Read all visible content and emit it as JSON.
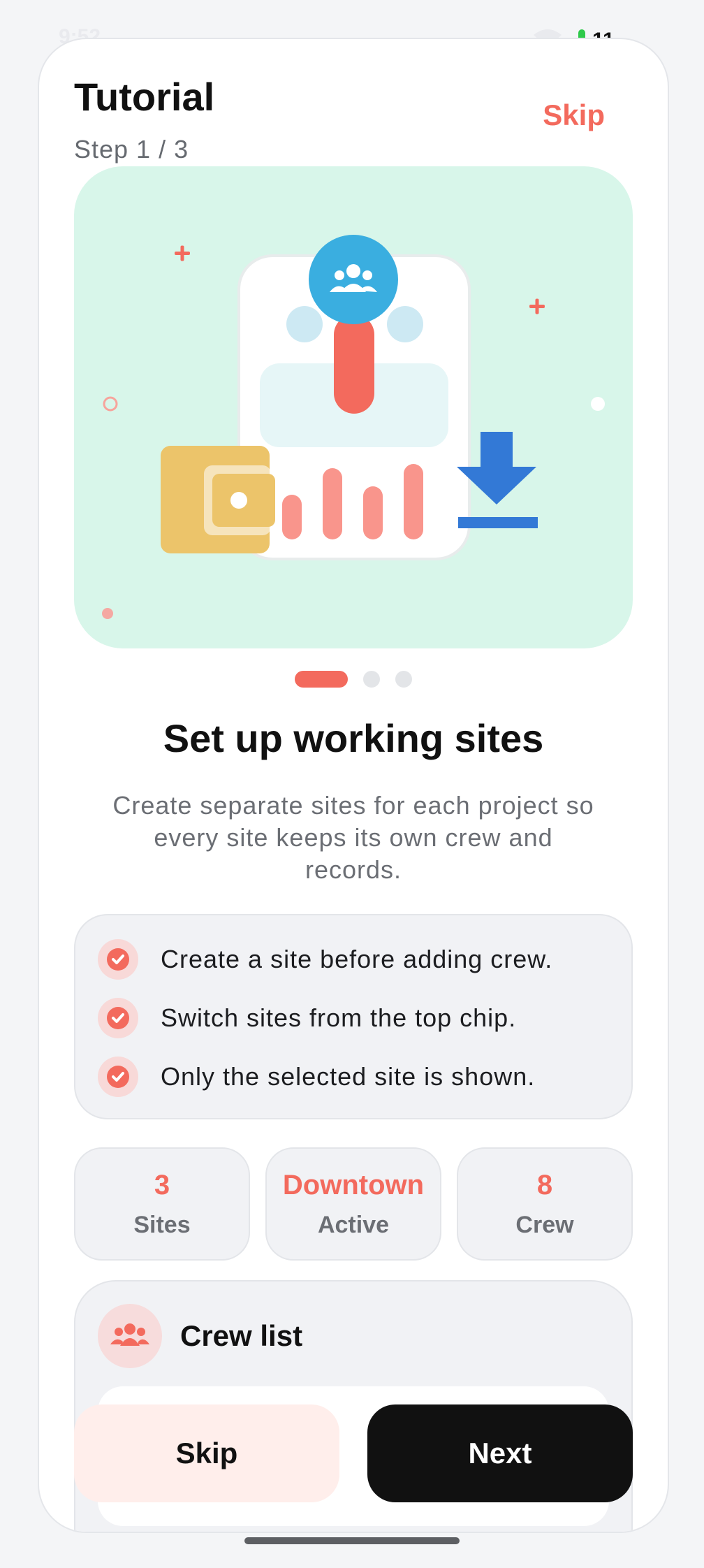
{
  "status_bar": {
    "time": "9:52",
    "battery": "11"
  },
  "header": {
    "title": "Tutorial",
    "step": "Step 1 / 3",
    "skip_label": "Skip"
  },
  "hero": {
    "illustration_icons": [
      "group-icon",
      "wallet-icon",
      "bar-chart-icon",
      "download-icon"
    ],
    "background_color": "#d8f6ea"
  },
  "pager": {
    "current": 1,
    "total": 3
  },
  "content": {
    "headline": "Set up working sites",
    "description": "Create separate sites for each project so every site keeps its own crew and records."
  },
  "checklist": [
    {
      "text": "Create a site before adding crew."
    },
    {
      "text": "Switch sites from the top chip."
    },
    {
      "text": "Only the selected site is shown."
    }
  ],
  "stats": [
    {
      "value": "3",
      "label": "Sites"
    },
    {
      "value": "Downtown",
      "label": "Active"
    },
    {
      "value": "8",
      "label": "Crew"
    }
  ],
  "crew_card": {
    "title": "Crew list",
    "icon": "group-icon"
  },
  "actions": {
    "skip_label": "Skip",
    "next_label": "Next"
  },
  "colors": {
    "accent": "#f36a5d",
    "primary_button": "#111111",
    "hero_bg": "#d8f6ea",
    "icon_blue": "#3aaee0"
  }
}
